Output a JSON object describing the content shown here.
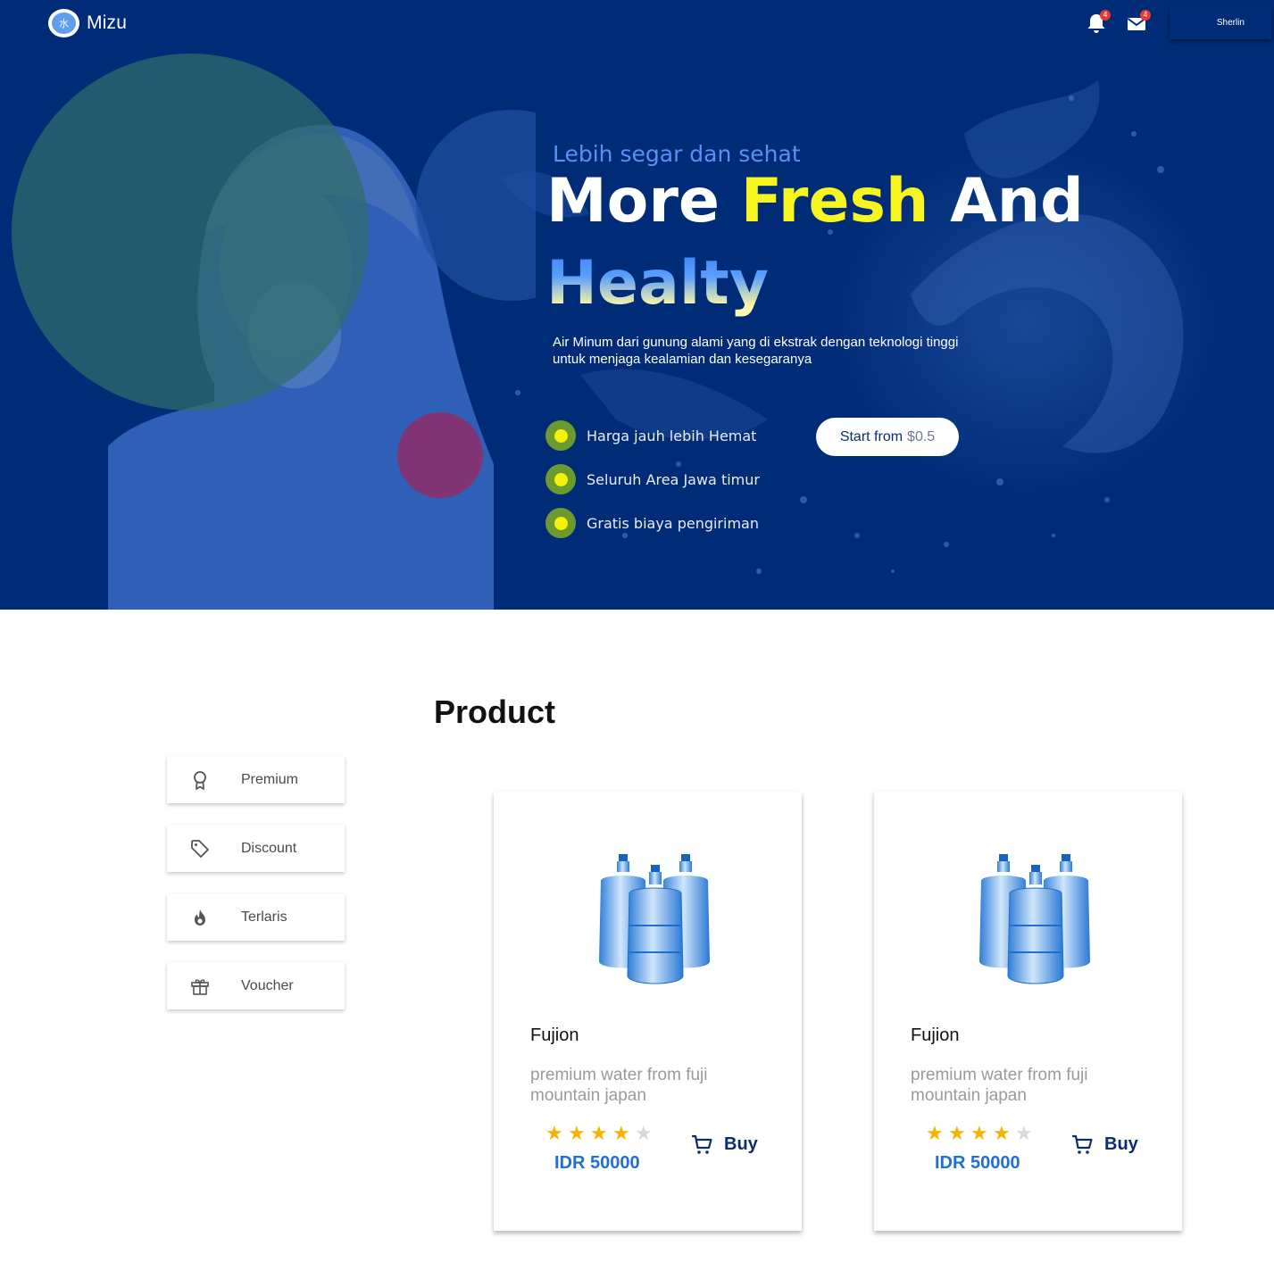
{
  "app": {
    "name": "Mizu",
    "logo_glyph": "水"
  },
  "header": {
    "notifications": {
      "icon": "bell-icon",
      "count": "4"
    },
    "messages": {
      "icon": "mail-icon",
      "count": "4"
    },
    "user_name": "Sherlin"
  },
  "hero": {
    "subtitle": "Lebih segar dan sehat",
    "title_part1": "More",
    "title_highlight": "Fresh",
    "title_part2": "And",
    "title_line2": "Healty",
    "description": "Air Minum dari gunung alami yang di ekstrak dengan teknologi tinggi untuk menjaga kealamian dan kesegaranya",
    "features": [
      "Harga jauh lebih Hemat",
      "Seluruh Area Jawa timur",
      "Gratis biaya pengiriman"
    ],
    "cta_label": "Start from",
    "cta_price": "$0.5"
  },
  "products": {
    "heading": "Product",
    "categories": [
      {
        "label": "Premium",
        "icon": "award-icon"
      },
      {
        "label": "Discount",
        "icon": "tag-icon"
      },
      {
        "label": "Terlaris",
        "icon": "fire-icon"
      },
      {
        "label": "Voucher",
        "icon": "gift-icon"
      }
    ],
    "items": [
      {
        "name": "Fujion",
        "description": "premium water from fuji mountain japan",
        "rating": 4,
        "rating_max": 5,
        "price": "IDR 50000",
        "buy_label": "Buy"
      },
      {
        "name": "Fujion",
        "description": "premium water from fuji mountain japan",
        "rating": 4,
        "rating_max": 5,
        "price": "IDR 50000",
        "buy_label": "Buy"
      }
    ]
  },
  "colors": {
    "hero_bg": "#002c77",
    "accent_yellow": "#f6f51f",
    "price_blue": "#1f6fd6",
    "star": "#f6b400"
  }
}
